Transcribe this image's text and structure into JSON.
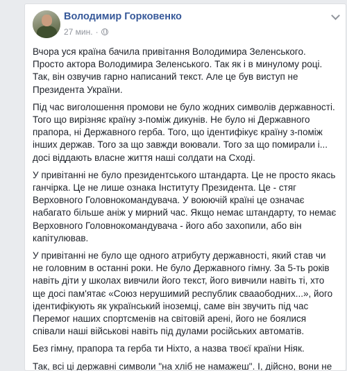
{
  "post": {
    "author": "Володимир Горковенко",
    "time": "27 мин.",
    "separator": "·",
    "privacy_icon": "globe-icon",
    "menu_icon": "chevron-down-icon",
    "paragraphs": [
      "Вчора уся країна бачила привітання Володимира Зеленського. Просто актора Володимира Зеленського. Так як і в минулому році. Так, він озвучив гарно написаний текст. Але це був виступ не Президента України.",
      "Під час виголошення промови не було жодних символів державності. Того що вирізняє країну з-поміж дикунів. Не було ні Державного прапора, ні Державного герба. Того, що ідентифікує країну з-поміж інших держав. Того за що завжди воювали. Того за що помирали і... досі віддають власне життя наші солдати на Сході.",
      "У привітанні не було президентського штандарта. Це не просто якась ганчірка. Це не лише ознака Інституту Президента. Це - стяг Верховного Головнокомандувача. У воюючій країні це означає набагато більше аніж у мирний час. Якщо немає штандарту, то немає Верховного Головнокомандувача - його або захопили, або він капітулював.",
      "У привітанні не було ще одного атрибуту державності, який став чи не головним в останні роки. Не було Державного гімну. За 5-ть років навіть діти у школах вивчили його текст, його вивчили навіть ті, хто ще досі пам'ятає «Союз нерушимий республик свааободних...», його ідентифікують як український іноземці, саме він звучить під час Перемог наших спортсменів на світовій арені, його не боялися співали наші військові навіть під дулами російських автоматів.",
      "Без гімну, прапора та герба ти Ніхто, а назва твоєї країни Ніяк.",
      "Так, всі ці державні символи \"на хліб не намажеш\". І, дійсно, вони не потрібні, якщо твоя країна - колонія."
    ]
  },
  "colors": {
    "page_bg": "#e9ebee",
    "card_bg": "#ffffff",
    "author_link": "#365899",
    "meta_text": "#90949c",
    "body_text": "#1d2129"
  }
}
